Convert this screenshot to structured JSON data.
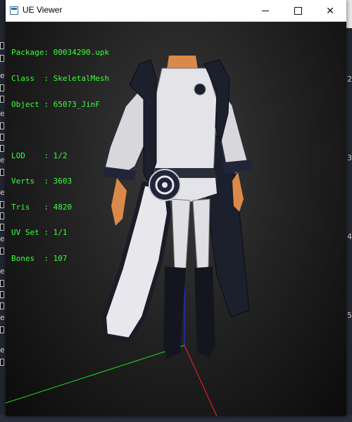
{
  "window": {
    "title": "UE Viewer",
    "minimize_glyph": "minimize-icon",
    "maximize_glyph": "maximize-icon",
    "close_label": "✕"
  },
  "info": {
    "package": "Package: 00034290.upk",
    "class": "Class  : SkeletalMesh",
    "object": "Object : 65073_JinF",
    "lod": "LOD    : 1/2",
    "verts": "Verts  : 3603",
    "tris": "Tris   : 4820",
    "uvset": "UV Set : 1/1",
    "bones": "Bones  : 107"
  },
  "background": {
    "right_numbers": [
      "2",
      "3",
      "4",
      "5"
    ],
    "left_marks": [
      "e",
      "e",
      "e",
      "e",
      "e",
      "e",
      "e",
      "e"
    ]
  },
  "colors": {
    "overlay_text": "#38ff38",
    "axis_x": "#ff2020",
    "axis_y": "#20dd20",
    "axis_z": "#2030ff"
  }
}
